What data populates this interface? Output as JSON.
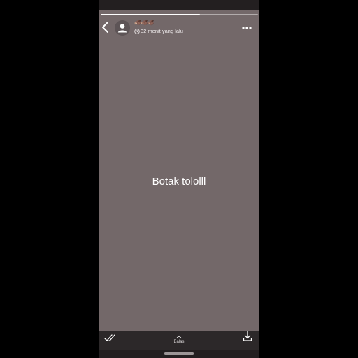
{
  "story": {
    "progress": 0.63,
    "background_color": "#736869",
    "text": "Botak tololll"
  },
  "header": {
    "username": "🐗🐗🐗",
    "timestamp": "32 menit yang lalu",
    "icons": {
      "back": "back-chevron-icon",
      "avatar": "default-avatar-icon",
      "time": "clock-icon",
      "more": "more-options-icon"
    }
  },
  "footer": {
    "reply_label": "Balas",
    "icons": {
      "seen": "double-check-icon",
      "reply": "chevron-up-icon",
      "download": "download-icon"
    }
  }
}
